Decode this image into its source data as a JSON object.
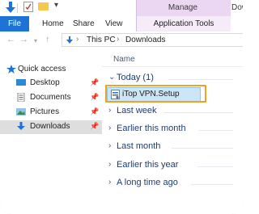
{
  "titlebar": {
    "manage_label": "Manage",
    "window_title_partial": "Downlc"
  },
  "ribbon": {
    "file_tab": "File",
    "tabs": [
      "Home",
      "Share",
      "View"
    ],
    "app_tools_tab": "Application Tools"
  },
  "address_bar": {
    "crumbs": [
      "This PC",
      "Downloads"
    ]
  },
  "navigation": {
    "quick_access_label": "Quick access",
    "items": [
      {
        "label": "Desktop",
        "icon": "desktop-icon",
        "pinned": true
      },
      {
        "label": "Documents",
        "icon": "documents-icon",
        "pinned": true
      },
      {
        "label": "Pictures",
        "icon": "pictures-icon",
        "pinned": true
      },
      {
        "label": "Downloads",
        "icon": "downloads-icon",
        "pinned": true,
        "selected": true
      }
    ]
  },
  "content": {
    "column_header": "Name",
    "groups": [
      {
        "label": "Today (1)",
        "expanded": true
      },
      {
        "label": "Last week",
        "expanded": false
      },
      {
        "label": "Earlier this month",
        "expanded": false
      },
      {
        "label": "Last month",
        "expanded": false
      },
      {
        "label": "Earlier this year",
        "expanded": false
      },
      {
        "label": "A long time ago",
        "expanded": false
      }
    ],
    "selected_file": "iTop VPN.Setup"
  },
  "colors": {
    "file_tab_bg": "#1e74d6",
    "app_tools_bg": "#ecd7f2",
    "selection_bg": "#cce6f8",
    "highlight_border": "#f0a220",
    "group_text": "#1e3c72"
  }
}
